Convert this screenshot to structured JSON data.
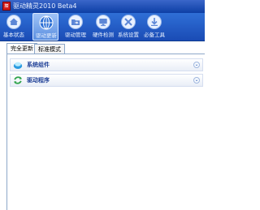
{
  "window": {
    "title": "驱动精灵2010 Beta4"
  },
  "toolbar": {
    "items": [
      {
        "label": "基本状态",
        "icon": "home-icon"
      },
      {
        "label": "驱动更新",
        "icon": "globe-icon",
        "active": true
      },
      {
        "label": "驱动管理",
        "icon": "folder-icon"
      },
      {
        "label": "硬件检测",
        "icon": "monitor-icon"
      },
      {
        "label": "系统设置",
        "icon": "tools-icon"
      },
      {
        "label": "必备工具",
        "icon": "download-icon"
      }
    ]
  },
  "tabs": [
    {
      "label": "完全更新",
      "selected": true
    },
    {
      "label": "标准模式",
      "selected": false
    }
  ],
  "groups": [
    {
      "label": "系统组件",
      "icon": "component-icon",
      "chevron": "chevron-down-icon"
    },
    {
      "label": "驱动程序",
      "icon": "refresh-icon",
      "chevron": "chevron-down-icon"
    }
  ]
}
